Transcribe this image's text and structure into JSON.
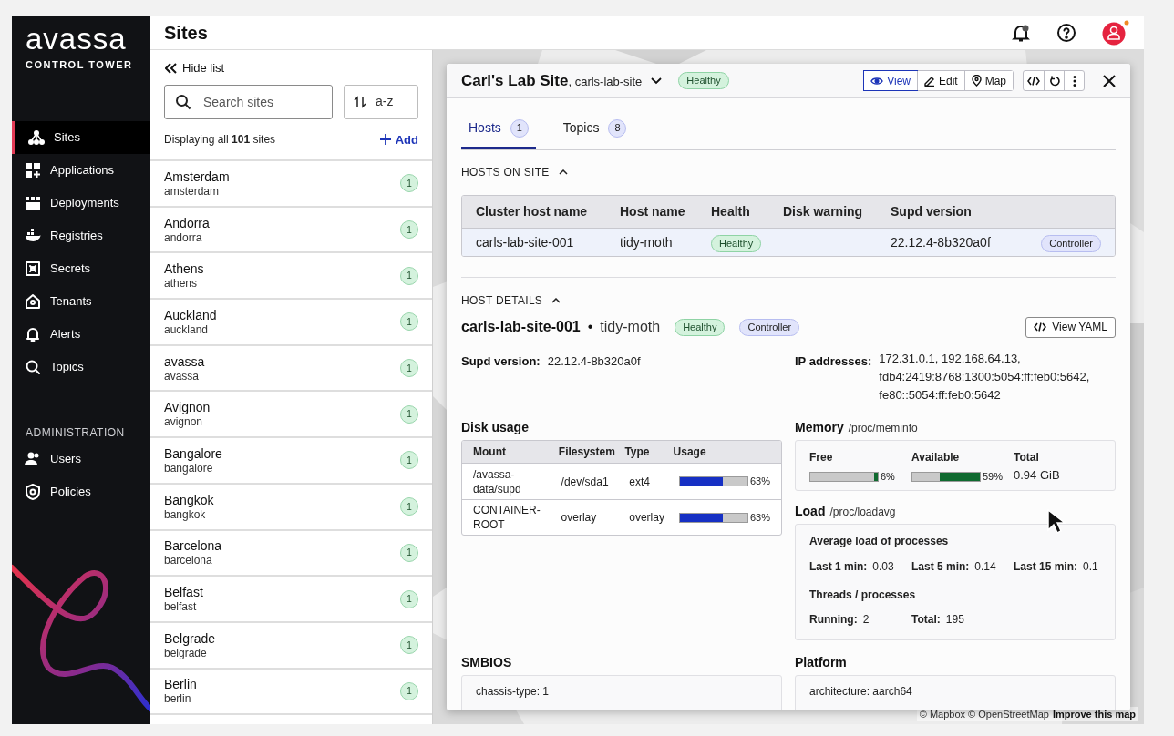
{
  "brand": {
    "name": "avassa",
    "subtitle": "CONTROL TOWER"
  },
  "nav": {
    "items": [
      {
        "label": "Sites",
        "selected": true
      },
      {
        "label": "Applications",
        "selected": false
      },
      {
        "label": "Deployments",
        "selected": false
      },
      {
        "label": "Registries",
        "selected": false
      },
      {
        "label": "Secrets",
        "selected": false
      },
      {
        "label": "Tenants",
        "selected": false
      },
      {
        "label": "Alerts",
        "selected": false
      },
      {
        "label": "Topics",
        "selected": false
      }
    ],
    "admin_heading": "ADMINISTRATION",
    "admin_items": [
      {
        "label": "Users",
        "selected": false
      },
      {
        "label": "Policies",
        "selected": false
      }
    ]
  },
  "page_title": "Sites",
  "site_list": {
    "hide_label": "Hide list",
    "search_placeholder": "Search sites",
    "sort": "a-z",
    "count_text": "Displaying all **101** sites",
    "add_label": "Add",
    "sites": [
      {
        "name": "Amsterdam",
        "slug": "amsterdam",
        "hosts": "1"
      },
      {
        "name": "Andorra",
        "slug": "andorra",
        "hosts": "1"
      },
      {
        "name": "Athens",
        "slug": "athens",
        "hosts": "1"
      },
      {
        "name": "Auckland",
        "slug": "auckland",
        "hosts": "1"
      },
      {
        "name": "avassa",
        "slug": "avassa",
        "hosts": "1"
      },
      {
        "name": "Avignon",
        "slug": "avignon",
        "hosts": "1"
      },
      {
        "name": "Bangalore",
        "slug": "bangalore",
        "hosts": "1"
      },
      {
        "name": "Bangkok",
        "slug": "bangkok",
        "hosts": "1"
      },
      {
        "name": "Barcelona",
        "slug": "barcelona",
        "hosts": "1"
      },
      {
        "name": "Belfast",
        "slug": "belfast",
        "hosts": "1"
      },
      {
        "name": "Belgrade",
        "slug": "belgrade",
        "hosts": "1"
      },
      {
        "name": "Berlin",
        "slug": "berlin",
        "hosts": "1"
      }
    ]
  },
  "map": {
    "kind": "picture",
    "attribution": "© Mapbox © OpenStreetMap",
    "improve": "Improve this map"
  },
  "detail": {
    "title": "Carl's Lab Site",
    "subtitle": ", carls-lab-site",
    "health": "Healthy",
    "modes": [
      {
        "label": "View",
        "selected": true
      },
      {
        "label": "Edit",
        "selected": false
      },
      {
        "label": "Map",
        "selected": false
      }
    ],
    "tabs": [
      {
        "label": "Hosts",
        "count": "1",
        "selected": true
      },
      {
        "label": "Topics",
        "count": "8",
        "selected": false
      }
    ],
    "hosts_section": {
      "title": "HOSTS ON SITE",
      "expanded": true,
      "columns": [
        "Cluster host name",
        "Host name",
        "Health",
        "Disk warning",
        "Supd version"
      ],
      "rows": [
        {
          "cluster_host": "carls-lab-site-001",
          "host": "tidy-moth",
          "health": "Healthy",
          "supd_version": "22.12.4-8b320a0f",
          "role": "Controller"
        }
      ]
    },
    "details_section": {
      "title": "HOST DETAILS",
      "expanded": true,
      "cluster_host": "carls-lab-site-001",
      "separator": "•",
      "host": "tidy-moth",
      "health": "Healthy",
      "role": "Controller",
      "yaml_button": "View YAML",
      "supd_label": "Supd version:",
      "supd_value": "22.12.4-8b320a0f",
      "ip_label": "IP addresses:",
      "ip_lines": [
        "172.31.0.1, 192.168.64.13,",
        "fdb4:2419:8768:1300:5054:ff:feb0:5642,",
        "fe80::5054:ff:feb0:5642"
      ],
      "disk": {
        "title": "Disk usage",
        "columns": [
          "Mount",
          "Filesystem",
          "Type",
          "Usage"
        ],
        "rows": [
          {
            "mount": "/avassa-data/supd",
            "filesystem": "/dev/sda1",
            "type": "ext4",
            "level": 0.63,
            "reading": "63%"
          },
          {
            "mount": "CONTAINER-ROOT",
            "filesystem": "overlay",
            "type": "overlay",
            "level": 0.63,
            "reading": "63%"
          }
        ]
      },
      "memory": {
        "title": "Memory",
        "source": "/proc/meminfo",
        "free": {
          "label": "Free",
          "level": 0.06,
          "reading": "6%"
        },
        "available": {
          "label": "Available",
          "level": 0.59,
          "reading": "59%"
        },
        "total_label": "Total",
        "total_value": "0.94 GiB"
      },
      "load": {
        "title": "Load",
        "source": "/proc/loadavg",
        "average_heading": "Average load of processes",
        "averages": [
          {
            "label": "Last 1 min:",
            "value": "0.03"
          },
          {
            "label": "Last 5 min:",
            "value": "0.14"
          },
          {
            "label": "Last 15 min:",
            "value": "0.1"
          }
        ],
        "threads_heading": "Threads / processes",
        "threads": [
          {
            "label": "Running:",
            "value": "2"
          },
          {
            "label": "Total:",
            "value": "195"
          }
        ]
      },
      "smbios": {
        "title": "SMBIOS",
        "lines": [
          "chassis-type: 1"
        ]
      },
      "platform": {
        "title": "Platform",
        "lines": [
          "architecture: aarch64"
        ]
      }
    }
  }
}
